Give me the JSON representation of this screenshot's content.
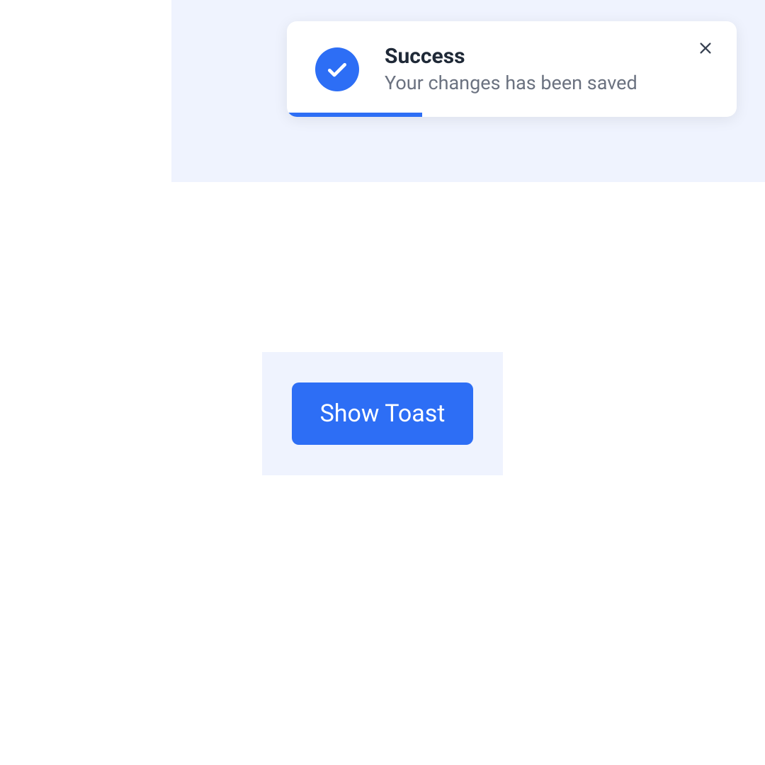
{
  "toast": {
    "title": "Success",
    "message": "Your changes has been saved",
    "icon_name": "check-icon",
    "close_label": "×",
    "progress_percent": 30,
    "accent_color": "#2d6ef5"
  },
  "button": {
    "label": "Show Toast"
  }
}
